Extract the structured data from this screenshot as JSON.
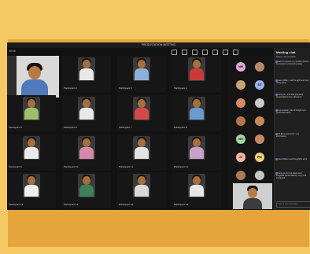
{
  "window": {
    "title": "PRESENTATION MEETING"
  },
  "toolbar": {
    "time": "00:46",
    "leave_label": "Leave",
    "icons": [
      "people-icon",
      "chat-icon",
      "raise-hand-icon",
      "more-icon",
      "camera-icon",
      "mic-icon",
      "share-icon"
    ]
  },
  "presenter": {
    "name": "Presenter"
  },
  "tiles": [
    {
      "name": "Participant 2",
      "shirt": "#e8e8e8"
    },
    {
      "name": "Participant 3",
      "shirt": "#8fb0d8"
    },
    {
      "name": "Participant 4",
      "shirt": "#c93b3b"
    },
    {
      "name": "Participant 5",
      "shirt": "#9bbf6a"
    },
    {
      "name": "Participant 6",
      "shirt": "#e9e9e9"
    },
    {
      "name": "Participant 7",
      "shirt": "#d24a4a"
    },
    {
      "name": "Participant 8",
      "shirt": "#6a9bd0"
    },
    {
      "name": "Participant 9",
      "shirt": "#eaeaea"
    },
    {
      "name": "Participant 10",
      "shirt": "#d38aa8"
    },
    {
      "name": "Participant 11",
      "shirt": "#e2e2e2"
    },
    {
      "name": "Participant 12",
      "shirt": "#c9a0c8"
    },
    {
      "name": "Participant 13",
      "shirt": "#efefef"
    },
    {
      "name": "Participant 14",
      "shirt": "#3f7f5a"
    },
    {
      "name": "Participant 15",
      "shirt": "#d9d9d9"
    },
    {
      "name": "Participant 16",
      "shirt": "#e7e7e7"
    }
  ],
  "roster": [
    {
      "initials": "NM",
      "color": "#e6a7d7"
    },
    {
      "initials": "",
      "color": "#b9876b"
    },
    {
      "initials": "",
      "color": "#caa46f"
    },
    {
      "initials": "ST",
      "color": "#9bb2e8"
    },
    {
      "initials": "",
      "color": "#d28c5e"
    },
    {
      "initials": "",
      "color": "#c9c9c9"
    },
    {
      "initials": "",
      "color": "#b8764a"
    },
    {
      "initials": "",
      "color": "#c7875a"
    },
    {
      "initials": "NG",
      "color": "#a5d6a7"
    },
    {
      "initials": "",
      "color": "#c38b65"
    },
    {
      "initials": "JV",
      "color": "#f1b9a1"
    },
    {
      "initials": "PM",
      "color": "#f2d27a"
    },
    {
      "initials": "",
      "color": "#ad7b53"
    },
    {
      "initials": "",
      "color": "#c5c5c5"
    }
  ],
  "chat": {
    "title": "Meeting chat",
    "subtitle": "Show conversation",
    "messages": [
      {
        "who": "",
        "text": "I want to express my sincere thanks to everyone presenting today"
      },
      {
        "who": "",
        "text": "It was brilliant, well thought and very nicely done"
      },
      {
        "who": "",
        "text": "Thank you, and well prepared presentations from all teams"
      },
      {
        "who": "",
        "text": "Great session, lots of insight and good discussion"
      },
      {
        "who": "",
        "text": "Well done everyone, very informative"
      },
      {
        "who": "",
        "text": "It was brilliant and thoughtful work"
      },
      {
        "who": "",
        "text": "Thank you for the lovely and insightful presentations, very well explained"
      }
    ],
    "input_placeholder": "Type a new message"
  },
  "colors": {
    "background": "#f4c964",
    "frame": "#e6a53c",
    "screen": "#121212",
    "leave": "#c4262e"
  }
}
